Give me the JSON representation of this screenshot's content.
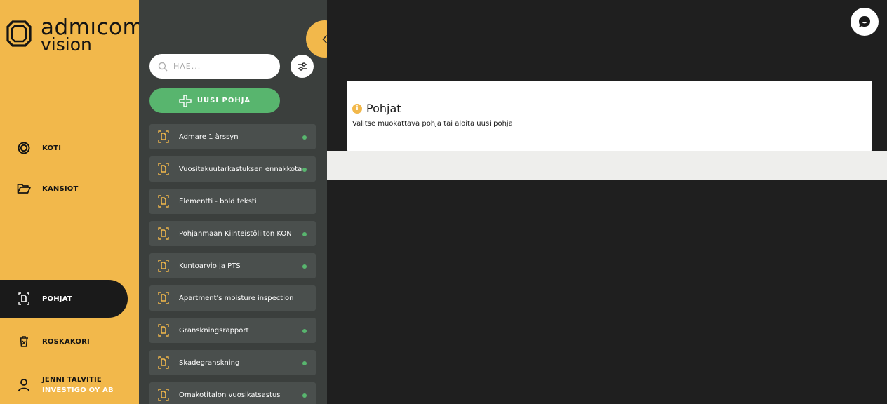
{
  "brand": {
    "line1": "admıcom",
    "line2": "vision"
  },
  "nav": {
    "home": "KOTI",
    "folders": "KANSIOT",
    "templates": "POHJAT",
    "trash": "ROSKAKORI",
    "user_name": "JENNI TALVITIE",
    "user_company": "INVESTIGO OY AB"
  },
  "search": {
    "placeholder": "HAE..."
  },
  "new_template_label": "UUSI POHJA",
  "templates": [
    {
      "label": "Admare 1 årssyn",
      "active": true
    },
    {
      "label": "Vuositakuutarkastuksen ennakkotarkastus",
      "active": true
    },
    {
      "label": "Elementti - bold teksti",
      "active": false
    },
    {
      "label": "Pohjanmaan Kiinteistöliiton KON",
      "active": true
    },
    {
      "label": "Kuntoarvio ja PTS",
      "active": true
    },
    {
      "label": "Apartment's moisture inspection",
      "active": false
    },
    {
      "label": "Granskningsrapport",
      "active": true
    },
    {
      "label": "Skadegranskning",
      "active": true
    },
    {
      "label": "Omakotitalon vuosikatsastus",
      "active": true
    }
  ],
  "main": {
    "title": "Pohjat",
    "subtitle": "Valitse muokattava pohja tai aloita uusi pohja"
  },
  "colors": {
    "accent": "#f2b84b",
    "green": "#58b56e",
    "panel": "#3b3f3d",
    "item": "#4a4f4d"
  }
}
